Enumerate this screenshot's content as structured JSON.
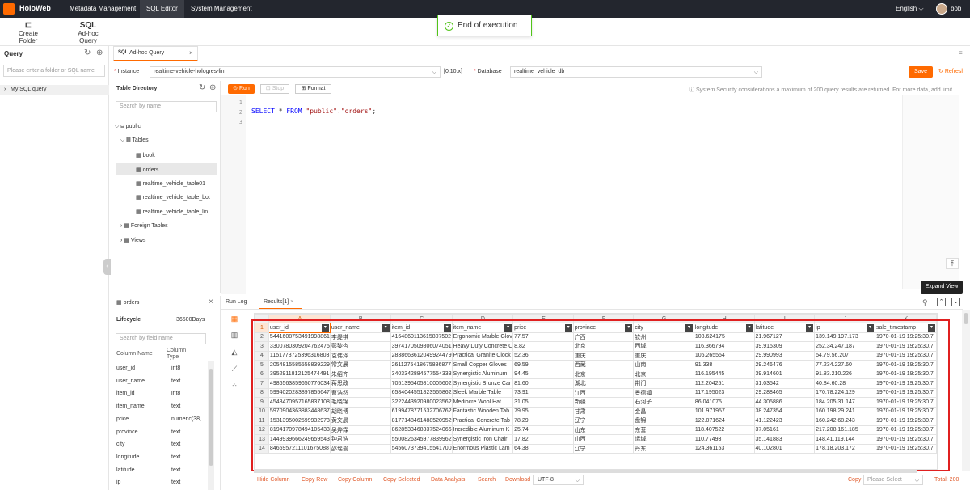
{
  "topbar": {
    "brand": "HoloWeb",
    "nav": [
      "Metadata Management",
      "SQL Editor",
      "System Management"
    ],
    "language": "English",
    "user": "bob"
  },
  "toolbar": {
    "create_folder": "Create Folder",
    "adhoc_query": "Ad-hoc Query",
    "sql_icon_text": "SQL"
  },
  "toast": {
    "message": "End of execution"
  },
  "left": {
    "query_title": "Query",
    "search_placeholder": "Please enter a folder or SQL name",
    "my_sql_query": "My SQL query"
  },
  "tab": {
    "label": "Ad-hoc Query",
    "prefix": "SQL"
  },
  "instance": {
    "label": "Instance",
    "value": "realtime-vehicle-hologres-lin",
    "version": "[0.10.x]",
    "database_label": "Database",
    "database_value": "realtime_vehicle_db",
    "save": "Save",
    "refresh": "Refresh"
  },
  "editor_toolbar": {
    "run": "Run",
    "stop": "Stop",
    "format": "Format",
    "notice": "System Security considerations a maximum of 200 query results are returned. For more data, add limit"
  },
  "table_directory": {
    "title": "Table Directory",
    "search_placeholder": "Search by name",
    "schema": "public",
    "tables_label": "Tables",
    "tables": [
      "book",
      "orders",
      "realtime_vehicle_table01",
      "realtime_vehicle_table_bot",
      "realtime_vehicle_table_lin"
    ],
    "foreign_tables": "Foreign Tables",
    "views": "Views"
  },
  "editor": {
    "line_numbers": [
      "1",
      "2",
      "3"
    ],
    "sql_keyword1": "SELECT",
    "sql_star": " * ",
    "sql_keyword2": "FROM",
    "sql_target": " \"public\".\"orders\"",
    "sql_end": ";"
  },
  "table_info": {
    "name": "orders",
    "lifecycle_label": "Lifecycle",
    "lifecycle_value": "36500Days",
    "field_search_placeholder": "Search by field name",
    "col_name_header": "Column Name",
    "col_type_header": "Column Type",
    "columns": [
      {
        "name": "user_id",
        "type": "int8"
      },
      {
        "name": "user_name",
        "type": "text"
      },
      {
        "name": "item_id",
        "type": "int8"
      },
      {
        "name": "item_name",
        "type": "text"
      },
      {
        "name": "price",
        "type": "numeric(38,..."
      },
      {
        "name": "province",
        "type": "text"
      },
      {
        "name": "city",
        "type": "text"
      },
      {
        "name": "longitude",
        "type": "text"
      },
      {
        "name": "latitude",
        "type": "text"
      },
      {
        "name": "ip",
        "type": "text"
      }
    ]
  },
  "results_tabs": {
    "run_log": "Run Log",
    "results": "Results[1]"
  },
  "tooltip": "Expand View",
  "grid": {
    "letters": [
      "A",
      "B",
      "C",
      "D",
      "E",
      "F",
      "G",
      "H",
      "I",
      "J",
      "K"
    ],
    "headers": [
      "user_id",
      "user_name",
      "item_id",
      "item_name",
      "price",
      "province",
      "city",
      "longitude",
      "latitude",
      "ip",
      "sale_timestamp"
    ],
    "rows": [
      [
        "5441608753491998861",
        "李缇祺",
        "4164860113615807502",
        "Ergonomic Marble Glov",
        "77.57",
        "广西",
        "钦州",
        "108.624175",
        "21.967127",
        "139.149.197.173",
        "1970-01-19 19:25:30.7"
      ],
      [
        "3300780309204762475",
        "彭黎杏",
        "3974170509806074051",
        "Heavy Duty Concrete C",
        "8.82",
        "北京",
        "西城",
        "116.366794",
        "39.915309",
        "252.34.247.187",
        "1970-01-19 19:25:30.7"
      ],
      [
        "1151773725396316803",
        "袁伟泽",
        "2838663612049924479",
        "Practical Granite Clock",
        "52.36",
        "重庆",
        "重庆",
        "106.265554",
        "29.990993",
        "54.79.56.207",
        "1970-01-19 19:25:30.7"
      ],
      [
        "2054815585558839229",
        "常文晨",
        "2611275418675886877",
        "Small Copper Gloves",
        "69.59",
        "西藏",
        "山南",
        "91.338",
        "29.246476",
        "77.234.227.60",
        "1970-01-19 19:25:30.7"
      ],
      [
        "3952911812125474491",
        "朱绍齐",
        "3403342884577554333",
        "Synergistic Aluminum",
        "94.45",
        "北京",
        "北京",
        "116.195445",
        "39.914601",
        "91.83.210.226",
        "1970-01-19 19:25:30.7"
      ],
      [
        "4986563859650776034",
        "蒋思政",
        "7051395405810005602",
        "Synergistic Bronze Car",
        "81.60",
        "湖北",
        "荆门",
        "112.204251",
        "31.03542",
        "40.84.60.28",
        "1970-01-19 19:25:30.7"
      ],
      [
        "5994020283897855647",
        "曹浩然",
        "6584044551823565862",
        "Sleek Marble Table",
        "73.91",
        "江西",
        "景德镇",
        "117.195023",
        "29.288465",
        "170.78.224.129",
        "1970-01-19 19:25:30.7"
      ],
      [
        "4548470957165837108",
        "毛晓锦",
        "3222443920980023562",
        "Mediocre Wool Hat",
        "31.05",
        "新疆",
        "石河子",
        "86.041075",
        "44.305886",
        "184.205.31.147",
        "1970-01-19 19:25:30.7"
      ],
      [
        "5970904363883448637",
        "胡晓博",
        "6199478771532706762",
        "Fantastic Wooden Tab",
        "79.95",
        "甘肃",
        "金昌",
        "101.971957",
        "38.247354",
        "160.198.29.241",
        "1970-01-19 19:25:30.7"
      ],
      [
        "1531395002599932973",
        "黄文晨",
        "8177148461488520952",
        "Practical Concrete Tab",
        "78.29",
        "辽宁",
        "盘锦",
        "122.071624",
        "41.122423",
        "160.242.68.243",
        "1970-01-19 19:25:30.7"
      ],
      [
        "8194170978494105433",
        "吴烨霖",
        "8628533468337524066",
        "Incredible Aluminum K",
        "25.74",
        "山东",
        "东营",
        "118.407522",
        "37.05161",
        "217.208.161.185",
        "1970-01-19 19:25:30.7"
      ],
      [
        "1449939666249659543",
        "钟君浩",
        "5500826345977839962",
        "Synergistic Iron Chair",
        "17.82",
        "山西",
        "运城",
        "110.77493",
        "35.141883",
        "148.41.119.144",
        "1970-01-19 19:25:30.7"
      ],
      [
        "8465957211101675088",
        "邵瑶瑜",
        "5456073739415541700",
        "Enormous Plastic Lam",
        "64.38",
        "辽宁",
        "丹东",
        "124.361153",
        "40.102801",
        "178.18.203.172",
        "1970-01-19 19:25:30.7"
      ]
    ]
  },
  "footer": {
    "actions": [
      "Hide Column",
      "Copy Row",
      "Copy Column",
      "Copy Selected",
      "Data Analysis",
      "Search",
      "Download"
    ],
    "encoding": "UTF-8",
    "copy": "Copy",
    "copy_select": "Please Select",
    "total": "Total: 200"
  }
}
